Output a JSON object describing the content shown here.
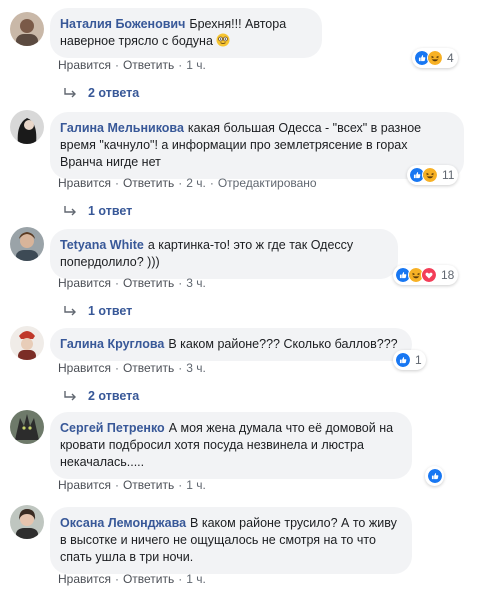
{
  "colors": {
    "link": "#385898",
    "bubble": "#f2f3f5",
    "meta": "#606770",
    "like": "#1877f2",
    "haha": "#f7b125",
    "love": "#f33e58"
  },
  "comments": [
    {
      "author": "Наталия Боженович",
      "text": "Брехня!!! Автора наверное трясло с бодуна",
      "like_label": "Нравится",
      "reply_label": "Ответить",
      "time": "1 ч.",
      "edited": "",
      "reactions": [
        "like-icon",
        "haha-icon"
      ],
      "reaction_count": "4",
      "replies": "2 ответа"
    },
    {
      "author": "Галина Мельникова",
      "text": "какая большая Одесса - \"всех\" в разное время \"качнуло\"! а информации про землетрясение в горах Вранча нигде нет",
      "like_label": "Нравится",
      "reply_label": "Ответить",
      "time": "2 ч.",
      "edited": "Отредактировано",
      "reactions": [
        "like-icon",
        "haha-icon"
      ],
      "reaction_count": "11",
      "replies": "1 ответ"
    },
    {
      "author": "Tetyana White",
      "text": "а картинка-то! это ж где так Одессу попердолило? )))",
      "like_label": "Нравится",
      "reply_label": "Ответить",
      "time": "3 ч.",
      "edited": "",
      "reactions": [
        "like-icon",
        "haha-icon",
        "love-icon"
      ],
      "reaction_count": "18",
      "replies": "1 ответ"
    },
    {
      "author": "Галина Круглова",
      "text": "В каком районе??? Сколько баллов???",
      "like_label": "Нравится",
      "reply_label": "Ответить",
      "time": "3 ч.",
      "edited": "",
      "reactions": [
        "like-icon"
      ],
      "reaction_count": "1",
      "replies": "2 ответа"
    },
    {
      "author": "Сергей Петренко",
      "text": "А моя жена думала что её домовой на кровати подбросил хотя посуда незвинела и люстра некачалась.....",
      "like_label": "Нравится",
      "reply_label": "Ответить",
      "time": "1 ч.",
      "edited": "",
      "reactions": [
        "like-icon"
      ],
      "reaction_count": "",
      "replies": ""
    },
    {
      "author": "Оксана Лемонджава",
      "text": "В каком районе трусило? А то живу в высотке и ничего не ощущалось не смотря на то что спать ушла в три ночи.",
      "like_label": "Нравится",
      "reply_label": "Ответить",
      "time": "1 ч.",
      "edited": "",
      "reactions": [],
      "reaction_count": "",
      "replies": ""
    }
  ]
}
